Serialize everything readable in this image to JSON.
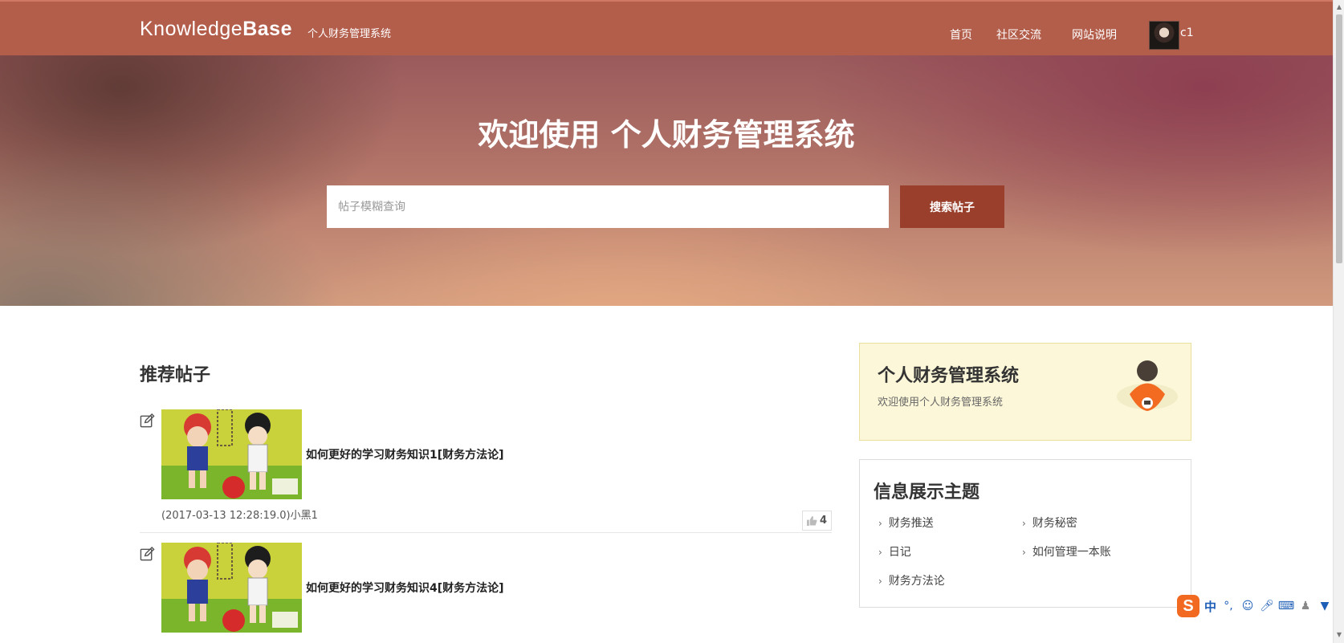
{
  "nav": {
    "brand_light": "Knowledge",
    "brand_bold": "Base",
    "subtitle": "个人财务管理系统",
    "links": [
      "首页",
      "社区交流",
      "网站说明"
    ],
    "user": "c1"
  },
  "hero": {
    "title": "欢迎使用 个人财务管理系统",
    "search_placeholder": "帖子模糊查询",
    "search_button": "搜索帖子"
  },
  "main": {
    "section_title": "推荐帖子",
    "posts": [
      {
        "title": "如何更好的学习财务知识1[财务方法论]",
        "meta": "(2017-03-13 12:28:19.0)小黑1",
        "likes": "4"
      },
      {
        "title": "如何更好的学习财务知识4[财务方法论]",
        "meta": ""
      }
    ]
  },
  "sidebar": {
    "info_card": {
      "title": "个人财务管理系统",
      "subtitle": "欢迎使用个人财务管理系统"
    },
    "topics_card": {
      "title": "信息展示主题",
      "topics": [
        "财务推送",
        "财务秘密",
        "日记",
        "如何管理一本账",
        "财务方法论"
      ]
    }
  },
  "ime": {
    "logo": "S",
    "mode": "中"
  },
  "colors": {
    "navbar": "#b35d4b",
    "search_button": "#9a3f2c",
    "info_card_bg": "#fcf7d8"
  }
}
